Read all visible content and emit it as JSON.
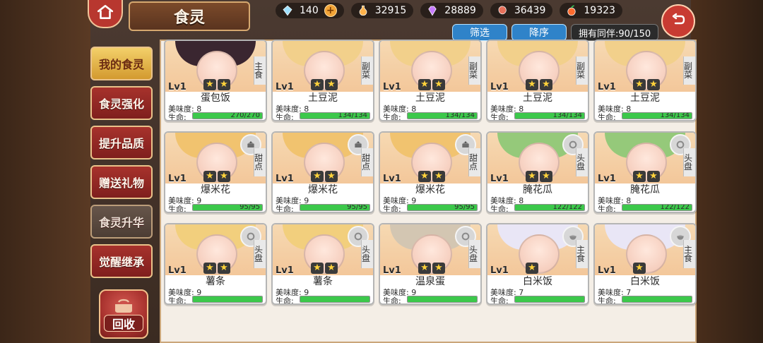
{
  "header": {
    "title": "食灵",
    "back_icon": "back-arrow-icon",
    "home_icon": "home-icon"
  },
  "resources": [
    {
      "name": "crystal",
      "value": "140",
      "has_plus": true,
      "icon": "crystal-icon"
    },
    {
      "name": "potion",
      "value": "32915",
      "has_plus": false,
      "icon": "potion-icon"
    },
    {
      "name": "gem",
      "value": "28889",
      "has_plus": false,
      "icon": "gem-icon"
    },
    {
      "name": "meat",
      "value": "36439",
      "has_plus": false,
      "icon": "meat-icon"
    },
    {
      "name": "fruit",
      "value": "19323",
      "has_plus": false,
      "icon": "fruit-icon"
    }
  ],
  "controls": {
    "filter": "筛选",
    "sort": "降序",
    "owned": "拥有同伴:90/150"
  },
  "menu": [
    {
      "label": "我的食灵",
      "state": "active"
    },
    {
      "label": "食灵强化",
      "state": "normal"
    },
    {
      "label": "提升品质",
      "state": "normal"
    },
    {
      "label": "赠送礼物",
      "state": "normal"
    },
    {
      "label": "食灵升华",
      "state": "ghost"
    },
    {
      "label": "觉醒继承",
      "state": "normal"
    }
  ],
  "recycle": {
    "label": "回收",
    "icon": "pot-icon"
  },
  "cards": [
    {
      "name": "蛋包饭",
      "lv": "Lv1",
      "stars": 2,
      "type": "主食",
      "meta": "美味度: 8",
      "hp": "270/270",
      "hp_ratio": 1,
      "hair": "#3a2630",
      "badge": "none"
    },
    {
      "name": "土豆泥",
      "lv": "Lv1",
      "stars": 2,
      "type": "副菜",
      "meta": "美味度: 8",
      "hp": "134/134",
      "hp_ratio": 1,
      "hair": "#f2d08b",
      "badge": "none"
    },
    {
      "name": "土豆泥",
      "lv": "Lv1",
      "stars": 2,
      "type": "副菜",
      "meta": "美味度: 8",
      "hp": "134/134",
      "hp_ratio": 1,
      "hair": "#f2d08b",
      "badge": "none"
    },
    {
      "name": "土豆泥",
      "lv": "Lv1",
      "stars": 2,
      "type": "副菜",
      "meta": "美味度: 8",
      "hp": "134/134",
      "hp_ratio": 1,
      "hair": "#f2d08b",
      "badge": "none"
    },
    {
      "name": "土豆泥",
      "lv": "Lv1",
      "stars": 2,
      "type": "副菜",
      "meta": "美味度: 8",
      "hp": "134/134",
      "hp_ratio": 1,
      "hair": "#f2d08b",
      "badge": "none"
    },
    {
      "name": "爆米花",
      "lv": "Lv1",
      "stars": 2,
      "type": "甜点",
      "meta": "美味度: 9",
      "hp": "95/95",
      "hp_ratio": 1,
      "hair": "#f1c36f",
      "badge": "cake"
    },
    {
      "name": "爆米花",
      "lv": "Lv1",
      "stars": 2,
      "type": "甜点",
      "meta": "美味度: 9",
      "hp": "95/95",
      "hp_ratio": 1,
      "hair": "#f1c36f",
      "badge": "cake"
    },
    {
      "name": "爆米花",
      "lv": "Lv1",
      "stars": 2,
      "type": "甜点",
      "meta": "美味度: 9",
      "hp": "95/95",
      "hp_ratio": 1,
      "hair": "#f1c36f",
      "badge": "cake"
    },
    {
      "name": "腌花瓜",
      "lv": "Lv1",
      "stars": 2,
      "type": "头盘",
      "meta": "美味度: 8",
      "hp": "122/122",
      "hp_ratio": 1,
      "hair": "#95c97a",
      "badge": "plate"
    },
    {
      "name": "腌花瓜",
      "lv": "Lv1",
      "stars": 2,
      "type": "头盘",
      "meta": "美味度: 8",
      "hp": "122/122",
      "hp_ratio": 1,
      "hair": "#95c97a",
      "badge": "plate"
    },
    {
      "name": "薯条",
      "lv": "Lv1",
      "stars": 2,
      "type": "头盘",
      "meta": "美味度: 9",
      "hp": "",
      "hp_ratio": 1,
      "hair": "#f2cf7d",
      "badge": "plate"
    },
    {
      "name": "薯条",
      "lv": "Lv1",
      "stars": 2,
      "type": "头盘",
      "meta": "美味度: 9",
      "hp": "",
      "hp_ratio": 1,
      "hair": "#f2cf7d",
      "badge": "plate"
    },
    {
      "name": "温泉蛋",
      "lv": "Lv1",
      "stars": 2,
      "type": "头盘",
      "meta": "美味度: 9",
      "hp": "",
      "hp_ratio": 1,
      "hair": "#d3c6b2",
      "badge": "plate"
    },
    {
      "name": "白米饭",
      "lv": "Lv1",
      "stars": 1,
      "type": "主食",
      "meta": "美味度: 7",
      "hp": "",
      "hp_ratio": 1,
      "hair": "#e9e6f6",
      "badge": "bowl"
    },
    {
      "name": "白米饭",
      "lv": "Lv1",
      "stars": 1,
      "type": "主食",
      "meta": "美味度: 7",
      "hp": "",
      "hp_ratio": 1,
      "hair": "#e9e6f6",
      "badge": "bowl"
    }
  ]
}
